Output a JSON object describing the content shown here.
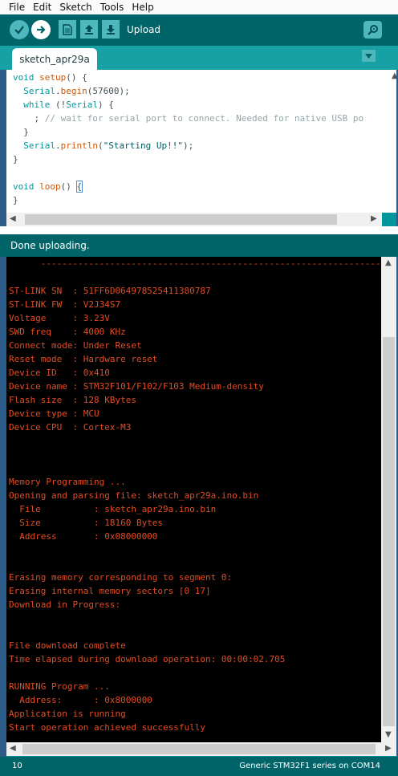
{
  "menu": [
    "File",
    "Edit",
    "Sketch",
    "Tools",
    "Help"
  ],
  "toolbar": {
    "hover_label": "Upload",
    "icons": [
      "verify-icon",
      "upload-icon",
      "new-icon",
      "open-icon",
      "save-icon",
      "serial-monitor-icon"
    ]
  },
  "tab": {
    "name": "sketch_apr29a"
  },
  "editor": {
    "lines": [
      "void setup() {",
      "  Serial.begin(57600);",
      "  while (!Serial) {",
      "    ; // wait for serial port to connect. Needed for native USB po",
      "  }",
      "  Serial.println(\"Starting Up!!\");",
      "}",
      "",
      "void loop() {",
      "}"
    ]
  },
  "status": {
    "message": "Done uploading."
  },
  "console": {
    "lines": [
      "      ----------------------------------------------------------------",
      "",
      "ST-LINK SN  : 51FF6D064978525411380787",
      "ST-LINK FW  : V2J34S7",
      "Voltage     : 3.23V",
      "SWD freq    : 4000 KHz",
      "Connect mode: Under Reset",
      "Reset mode  : Hardware reset",
      "Device ID   : 0x410",
      "Device name : STM32F101/F102/F103 Medium-density",
      "Flash size  : 128 KBytes",
      "Device type : MCU",
      "Device CPU  : Cortex-M3",
      "",
      "",
      "",
      "Memory Programming ...",
      "Opening and parsing file: sketch_apr29a.ino.bin",
      "  File          : sketch_apr29a.ino.bin",
      "  Size          : 18160 Bytes",
      "  Address       : 0x08000000",
      "",
      "",
      "Erasing memory corresponding to segment 0:",
      "Erasing internal memory sectors [0 17]",
      "Download in Progress:",
      "",
      "",
      "File download complete",
      "Time elapsed during download operation: 00:00:02.705",
      "",
      "RUNNING Program ...",
      "  Address:      : 0x8000000",
      "Application is running",
      "Start operation achieved successfully"
    ]
  },
  "footer": {
    "line_number": "10",
    "board": "Generic STM32F1 series on COM14"
  },
  "colors": {
    "toolbar_bg": "#006468",
    "tab_bar_bg": "#17a1a5",
    "console_text": "#e34c22",
    "keyword": "#00979c",
    "function": "#d35400"
  }
}
